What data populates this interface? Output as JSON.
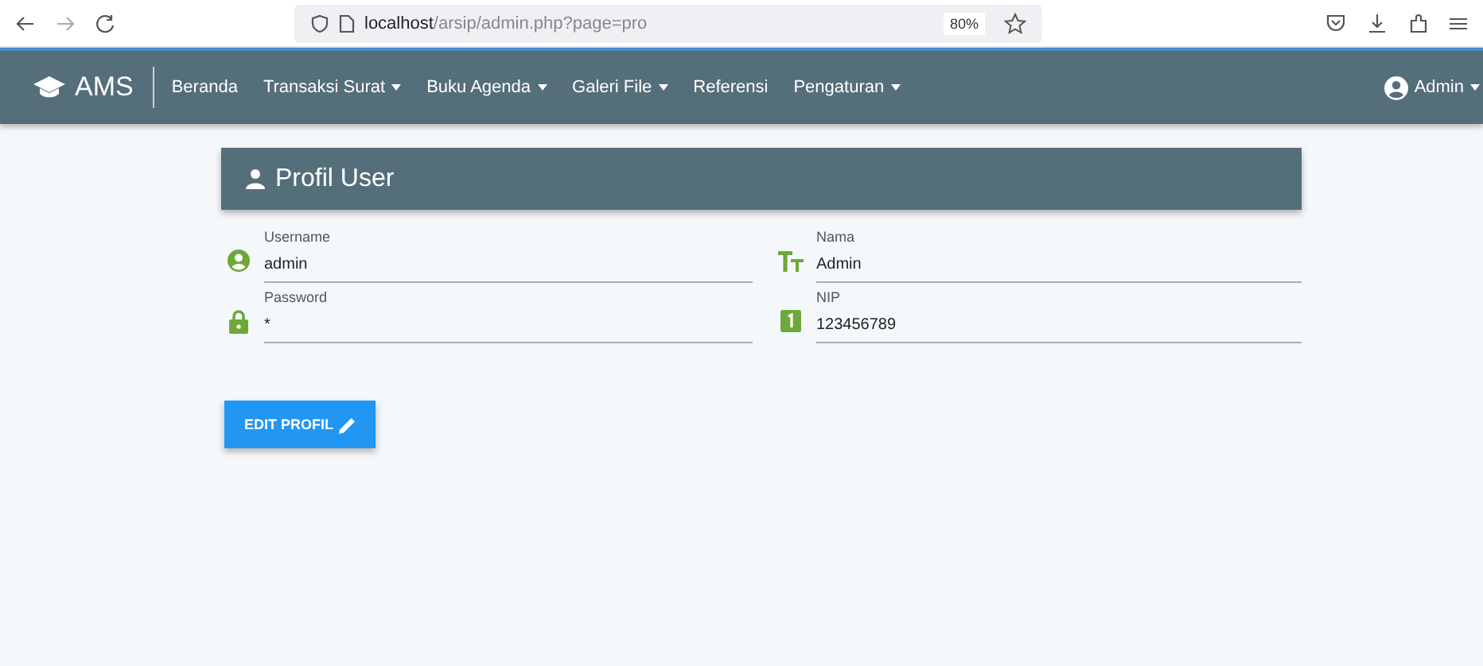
{
  "browser": {
    "url_host": "localhost",
    "url_path": "/arsip/admin.php?page=pro",
    "zoom": "80%"
  },
  "navbar": {
    "brand": "AMS",
    "items": [
      {
        "label": "Beranda",
        "dropdown": false
      },
      {
        "label": "Transaksi Surat",
        "dropdown": true
      },
      {
        "label": "Buku Agenda",
        "dropdown": true
      },
      {
        "label": "Galeri File",
        "dropdown": true
      },
      {
        "label": "Referensi",
        "dropdown": false
      },
      {
        "label": "Pengaturan",
        "dropdown": true
      }
    ],
    "user": {
      "label": "Admin",
      "dropdown": true
    }
  },
  "card": {
    "title": "Profil User",
    "fields": [
      {
        "label": "Username",
        "value": "admin"
      },
      {
        "label": "Nama",
        "value": "Admin"
      },
      {
        "label": "Password",
        "value": "*"
      },
      {
        "label": "NIP",
        "value": "123456789"
      }
    ]
  },
  "button": "EDIT PROFIL"
}
